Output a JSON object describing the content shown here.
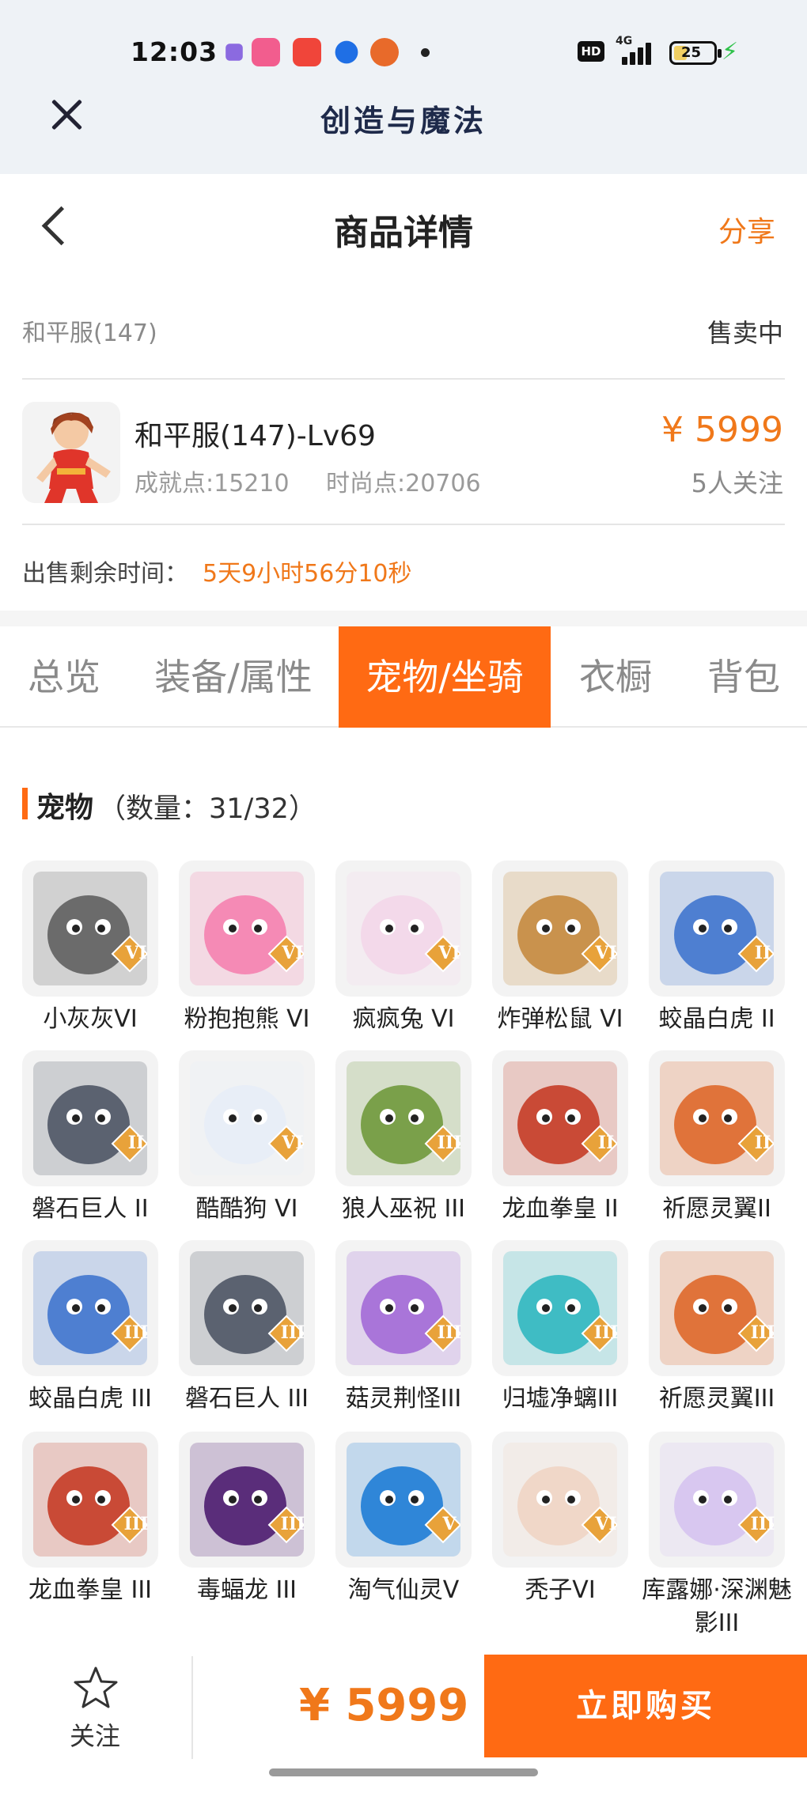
{
  "status_bar": {
    "time": "12:03",
    "network": "4G",
    "battery": "25"
  },
  "app_bar": {
    "title": "创造与魔法",
    "close_icon": "close-icon"
  },
  "header": {
    "title": "商品详情",
    "share_label": "分享",
    "back_icon": "back-arrow-icon"
  },
  "listing": {
    "server": "和平服(147)",
    "status": "售卖中",
    "role_name": "和平服(147)-Lv69",
    "achievement": "成就点:15210",
    "fashion": "时尚点:20706",
    "price": "¥ 5999",
    "followers": "5人关注",
    "remaining_label": "出售剩余时间：",
    "remaining_value": "5天9小时56分10秒"
  },
  "tabs": [
    {
      "label": "总览",
      "active": false
    },
    {
      "label": "装备/属性",
      "active": false
    },
    {
      "label": "宠物/坐骑",
      "active": true
    },
    {
      "label": "衣橱",
      "active": false
    },
    {
      "label": "背包",
      "active": false
    }
  ],
  "pets": {
    "title": "宠物",
    "count": "（数量：31/32）",
    "items": [
      {
        "name": "小灰灰VI",
        "rank": "VI",
        "color": "#6b6b6b"
      },
      {
        "name": "粉抱抱熊 VI",
        "rank": "VI",
        "color": "#f58ab5"
      },
      {
        "name": "疯疯兔 VI",
        "rank": "VI",
        "color": "#f3d9ea"
      },
      {
        "name": "炸弹松鼠 VI",
        "rank": "VI",
        "color": "#c9924d"
      },
      {
        "name": "蛟晶白虎 II",
        "rank": "II",
        "color": "#4e7fd1"
      },
      {
        "name": "磐石巨人 II",
        "rank": "II",
        "color": "#5b6270"
      },
      {
        "name": "酷酷狗 VI",
        "rank": "VI",
        "color": "#e8eef7"
      },
      {
        "name": "狼人巫祝 III",
        "rank": "III",
        "color": "#7aa04a"
      },
      {
        "name": "龙血拳皇 II",
        "rank": "II",
        "color": "#c94a36"
      },
      {
        "name": "祈愿灵翼II",
        "rank": "II",
        "color": "#e0733a"
      },
      {
        "name": "蛟晶白虎 III",
        "rank": "III",
        "color": "#4e7fd1"
      },
      {
        "name": "磐石巨人 III",
        "rank": "III",
        "color": "#5b6270"
      },
      {
        "name": "菇灵荆怪III",
        "rank": "III",
        "color": "#a975d9"
      },
      {
        "name": "归墟净螭III",
        "rank": "III",
        "color": "#3fbcc4"
      },
      {
        "name": "祈愿灵翼III",
        "rank": "III",
        "color": "#e0733a"
      },
      {
        "name": "龙血拳皇 III",
        "rank": "III",
        "color": "#c94a36"
      },
      {
        "name": "毒蝠龙 III",
        "rank": "III",
        "color": "#5a2d7a"
      },
      {
        "name": "淘气仙灵V",
        "rank": "V",
        "color": "#2f86d8"
      },
      {
        "name": "秃子VI",
        "rank": "VI",
        "color": "#f0d7c8"
      },
      {
        "name": "库露娜·深渊魅影III",
        "rank": "III",
        "color": "#d8c7f0"
      }
    ]
  },
  "bottom_bar": {
    "follow_label": "关注",
    "total_price": "¥ 5999",
    "buy_label": "立即购买"
  },
  "colors": {
    "accent": "#ff6a13",
    "price": "#f0781a",
    "rank_badge": "#e8a23a"
  }
}
